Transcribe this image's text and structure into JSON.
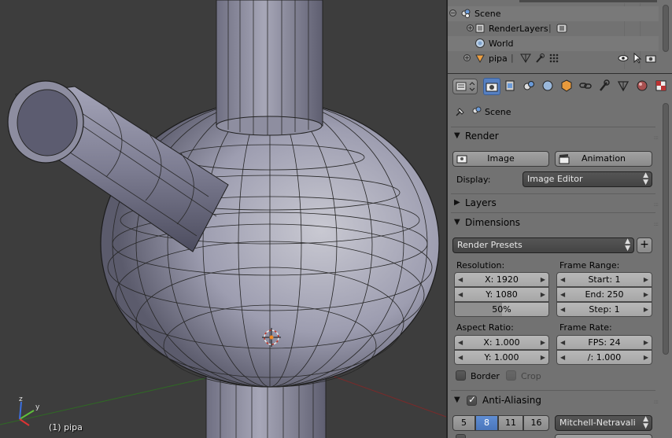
{
  "viewport": {
    "active_object_label": "(1) pipa",
    "axis_x": "x",
    "axis_y": "y",
    "axis_z": "z"
  },
  "outliner": {
    "rows": [
      {
        "label": "Scene",
        "icon": "scene-icon",
        "toggle": "−"
      },
      {
        "label": "RenderLayers",
        "icon": "render-layers-icon",
        "toggle": "+"
      },
      {
        "label": "World",
        "icon": "world-icon",
        "toggle": ""
      },
      {
        "label": "pipa",
        "icon": "mesh-object-icon",
        "toggle": "+"
      }
    ]
  },
  "properties": {
    "context_path": "Scene",
    "tabs": [
      "render-tab",
      "render-layers-tab",
      "scene-tab",
      "world-tab",
      "object-tab",
      "constraints-tab",
      "modifiers-tab",
      "data-tab",
      "material-tab",
      "texture-tab",
      "physics-tab"
    ],
    "active_tab": "render-tab",
    "render": {
      "title": "Render",
      "image_button": "Image",
      "animation_button": "Animation",
      "display_label": "Display:",
      "display_value": "Image Editor"
    },
    "layers": {
      "title": "Layers"
    },
    "dimensions": {
      "title": "Dimensions",
      "presets": "Render Presets",
      "resolution_label": "Resolution:",
      "res_x": "X: 1920",
      "res_y": "Y: 1080",
      "res_percent": "50%",
      "res_percent_value": 0.5,
      "frame_range_label": "Frame Range:",
      "start": "Start: 1",
      "end": "End: 250",
      "step": "Step: 1",
      "aspect_label": "Aspect Ratio:",
      "aspect_x": "X: 1.000",
      "aspect_y": "Y: 1.000",
      "frame_rate_label": "Frame Rate:",
      "fps": "FPS: 24",
      "fps_base": "/: 1.000",
      "border_label": "Border",
      "crop_label": "Crop"
    },
    "anti_aliasing": {
      "title": "Anti-Aliasing",
      "samples": [
        "5",
        "8",
        "11",
        "16"
      ],
      "selected_sample": "8",
      "filter": "Mitchell-Netravali"
    }
  },
  "colors": {
    "selected_blue": "#5680c2",
    "panel_bg": "#727272",
    "viewport_bg": "#3d3d3d"
  }
}
